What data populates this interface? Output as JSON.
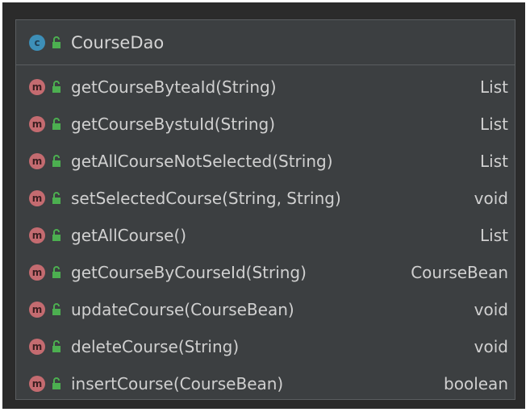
{
  "class_box": {
    "type_letter": "c",
    "name": "CourseDao"
  },
  "method_letter": "m",
  "methods": [
    {
      "signature": "getCourseByteaId(String)",
      "returns": "List"
    },
    {
      "signature": "getCourseBystuId(String)",
      "returns": "List"
    },
    {
      "signature": "getAllCourseNotSelected(String)",
      "returns": "List"
    },
    {
      "signature": "setSelectedCourse(String, String)",
      "returns": "void"
    },
    {
      "signature": "getAllCourse()",
      "returns": "List"
    },
    {
      "signature": "getCourseByCourseId(String)",
      "returns": "CourseBean"
    },
    {
      "signature": "updateCourse(CourseBean)",
      "returns": "void"
    },
    {
      "signature": "deleteCourse(String)",
      "returns": "void"
    },
    {
      "signature": "insertCourse(CourseBean)",
      "returns": "boolean"
    }
  ],
  "colors": {
    "class_badge": "#3d8fb8",
    "method_badge": "#c46b70",
    "lock_icon": "#4caf50",
    "background": "#3c3f41",
    "text": "#d0d0d0"
  },
  "icons": {
    "class": "class-icon",
    "method": "method-icon",
    "visibility": "public-lock-icon"
  }
}
